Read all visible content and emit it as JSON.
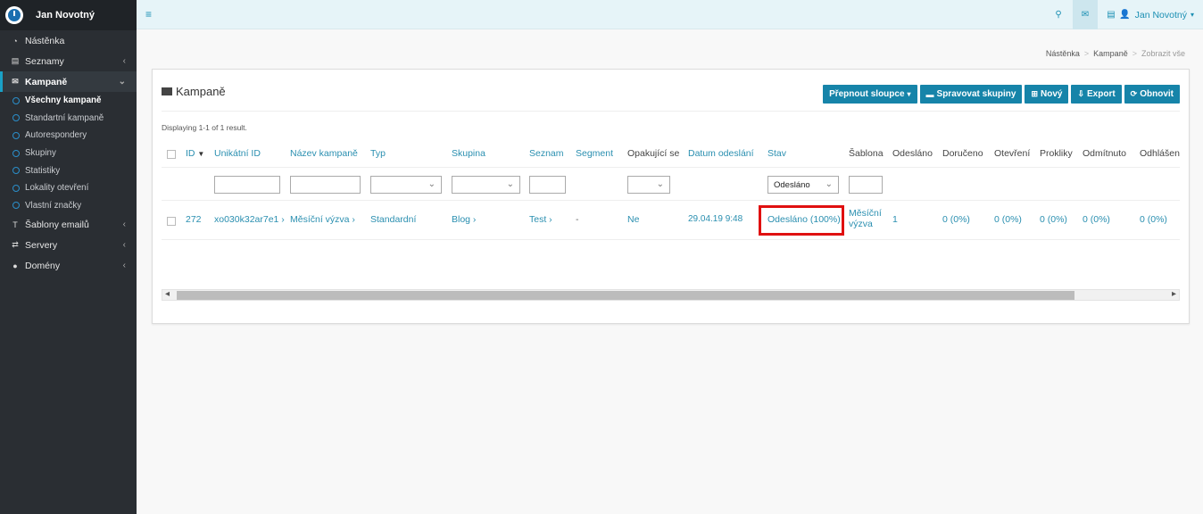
{
  "brand": {
    "name": "Jan Novotný"
  },
  "sidebar": {
    "items": [
      {
        "label": "Nástěnka",
        "icon": "dashboard-icon"
      },
      {
        "label": "Seznamy",
        "icon": "list-icon"
      },
      {
        "label": "Kampaně",
        "icon": "envelope-icon"
      },
      {
        "label": "Šablony emailů",
        "icon": "text-icon"
      },
      {
        "label": "Servery",
        "icon": "exchange-icon"
      },
      {
        "label": "Domény",
        "icon": "globe-icon"
      }
    ],
    "subitems": [
      "Všechny kampaně",
      "Standartní kampaně",
      "Autorespondery",
      "Skupiny",
      "Statistiky",
      "Lokality otevření",
      "Vlastní značky"
    ]
  },
  "topbar": {
    "user": "Jan Novotný"
  },
  "breadcrumb": {
    "items": [
      "Nástěnka",
      "Kampaně",
      "Zobrazit vše"
    ]
  },
  "panel": {
    "title": "Kampaně",
    "summary": "Displaying 1-1 of 1 result.",
    "buttons": [
      "Přepnout sloupce",
      "Spravovat skupiny",
      "Nový",
      "Export",
      "Obnovit"
    ]
  },
  "table": {
    "headers": [
      "ID",
      "Unikátní ID",
      "Název kampaně",
      "Typ",
      "Skupina",
      "Seznam",
      "Segment",
      "Opakující se",
      "Datum odeslání",
      "Stav",
      "Šablona",
      "Odesláno",
      "Doručeno",
      "Otevření",
      "Prokliky",
      "Odmítnuto",
      "Odhlášen"
    ],
    "status_filter": "Odesláno",
    "row": {
      "id": "272",
      "unique_id": "xo030k32ar7e1 ›",
      "name": "Měsíční výzva ›",
      "type": "Standardní",
      "group": "Blog ›",
      "list": "Test ›",
      "segment": "-",
      "recurring": "Ne",
      "send_date": "29.04.19 9:48",
      "status": "Odesláno (100%)",
      "template_l1": "Měsíční",
      "template_l2": "výzva",
      "sent": "1",
      "delivered": "0 (0%)",
      "opens": "0 (0%)",
      "clicks": "0 (0%)",
      "bounced": "0 (0%)",
      "unsub": "0 (0%)"
    }
  },
  "colors": {
    "accent": "#1684a9",
    "sidebar_bg": "#2a2e33",
    "highlight": "#e01010"
  }
}
